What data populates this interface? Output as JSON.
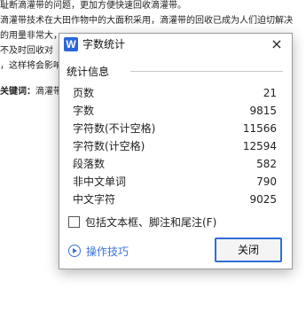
{
  "document": {
    "lines": [
      "耻断滴灌带的问题，更加方便快速回收滴灌带。",
      "滴灌带技术在大田作物中的大面积采用，滴灌带的回收已成为人们迫切解决",
      "的用量非常大，",
      "不及时回收对",
      "，这样将会影响"
    ],
    "keyword_label": "关键词：",
    "keyword_text": "滴灌带"
  },
  "dialog": {
    "app_icon_letter": "W",
    "title": "字数统计",
    "close_icon": "×",
    "group_label": "统计信息",
    "stats": [
      {
        "label": "页数",
        "value": "21"
      },
      {
        "label": "字数",
        "value": "9815"
      },
      {
        "label": "字符数(不计空格)",
        "value": "11566"
      },
      {
        "label": "字符数(计空格)",
        "value": "12594"
      },
      {
        "label": "段落数",
        "value": "582"
      },
      {
        "label": "非中文单词",
        "value": "790"
      },
      {
        "label": "中文字符",
        "value": "9025"
      }
    ],
    "checkbox_label": "包括文本框、脚注和尾注(F)",
    "checkbox_checked": false,
    "tips_label": "操作技巧",
    "close_button_label": "关闭",
    "accent_color": "#2f6fd6",
    "link_color": "#3a73d8"
  }
}
